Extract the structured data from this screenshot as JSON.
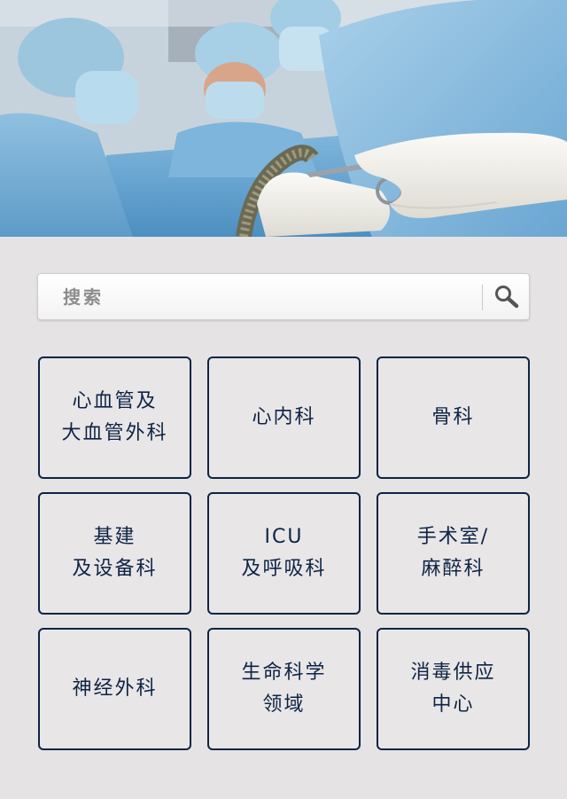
{
  "search": {
    "placeholder": "搜索",
    "icon": "search-icon"
  },
  "categories": [
    {
      "line1": "心血管及",
      "line2": "大血管外科"
    },
    {
      "line1": "心内科",
      "line2": ""
    },
    {
      "line1": "骨科",
      "line2": ""
    },
    {
      "line1": "基建",
      "line2": "及设备科"
    },
    {
      "line1": "ICU",
      "line2": "及呼吸科"
    },
    {
      "line1": "手术室/",
      "line2": "麻醉科"
    },
    {
      "line1": "神经外科",
      "line2": ""
    },
    {
      "line1": "生命科学",
      "line2": "领域"
    },
    {
      "line1": "消毒供应",
      "line2": "中心"
    }
  ],
  "colors": {
    "tile_border": "#0d2445",
    "tile_text": "#0d2445",
    "background": "#e6e3e4"
  }
}
